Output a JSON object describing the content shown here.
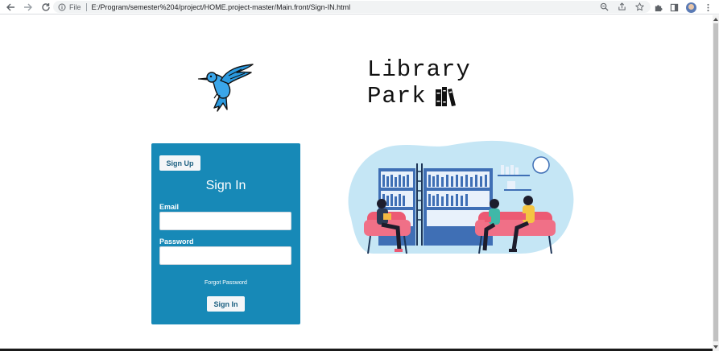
{
  "browser": {
    "url_scheme_label": "File",
    "url": "E:/Program/semester%204/project/HOME.project-master/Main.front/Sign-IN.html",
    "icons": [
      "back-arrow-icon",
      "forward-arrow-icon",
      "reload-icon",
      "info-icon",
      "zoom-icon",
      "share-icon",
      "star-icon",
      "extensions-icon",
      "side-panel-icon",
      "avatar",
      "menu-dots-icon"
    ]
  },
  "brand": {
    "line1": "Library",
    "line2": "Park",
    "logo_icon": "hummingbird-icon",
    "books_icon": "books-icon"
  },
  "signin_card": {
    "signup_label": "Sign Up",
    "title": "Sign In",
    "email_label": "Email",
    "email_value": "",
    "password_label": "Password",
    "password_value": "",
    "forgot_label": "Forgot Password",
    "submit_label": "Sign In"
  },
  "colors": {
    "card_bg": "#1789b7",
    "button_text": "#1b5f80",
    "illustration_blob": "#c5e6f5"
  },
  "illustration": {
    "name": "library-reading-illustration"
  }
}
